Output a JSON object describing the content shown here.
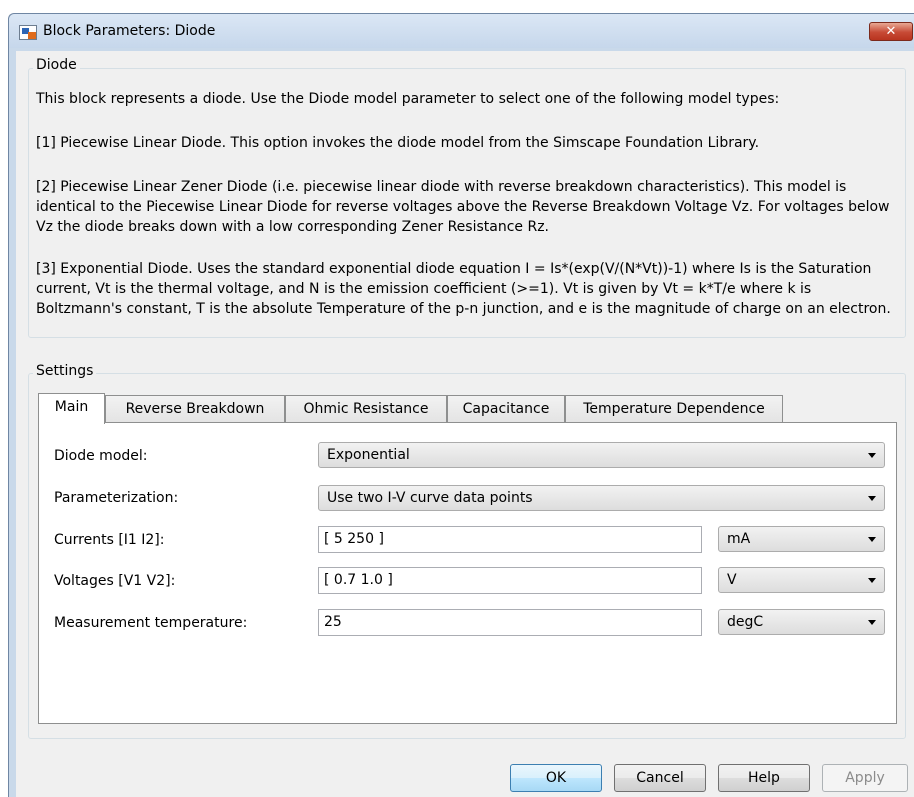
{
  "window": {
    "title": "Block Parameters: Diode",
    "close_label": "✕"
  },
  "diode_group": {
    "label": "Diode",
    "paragraphs": [
      "This block represents a diode. Use the Diode model parameter to select one of the following model types:",
      "[1] Piecewise Linear Diode. This option invokes the diode model from the Simscape Foundation Library.",
      "[2] Piecewise Linear Zener Diode (i.e. piecewise linear diode with reverse breakdown characteristics). This model is identical to the Piecewise Linear Diode for reverse voltages above the Reverse Breakdown Voltage Vz. For voltages below Vz the diode breaks down with a low corresponding Zener Resistance Rz.",
      "[3] Exponential Diode. Uses the standard exponential diode equation I = Is*(exp(V/(N*Vt))-1) where Is is the Saturation current, Vt is the thermal voltage, and N is the emission coefficient (>=1). Vt is given by Vt = k*T/e where k is Boltzmann's constant, T is the absolute Temperature of the p-n junction, and e is the magnitude of charge on an electron."
    ]
  },
  "settings": {
    "label": "Settings",
    "tabs": [
      {
        "label": "Main"
      },
      {
        "label": "Reverse Breakdown"
      },
      {
        "label": "Ohmic Resistance"
      },
      {
        "label": "Capacitance"
      },
      {
        "label": "Temperature Dependence"
      }
    ],
    "diode_model": {
      "label": "Diode model:",
      "value": "Exponential"
    },
    "parameterization": {
      "label": "Parameterization:",
      "value": "Use two I-V curve data points"
    },
    "currents": {
      "label": "Currents [I1 I2]:",
      "value": "[ 5 250 ]",
      "unit": "mA"
    },
    "voltages": {
      "label": "Voltages [V1 V2]:",
      "value": "[ 0.7 1.0 ]",
      "unit": "V"
    },
    "measurement_temperature": {
      "label": "Measurement temperature:",
      "value": "25",
      "unit": "degC"
    }
  },
  "buttons": {
    "ok": "OK",
    "cancel": "Cancel",
    "help": "Help",
    "apply": "Apply"
  }
}
